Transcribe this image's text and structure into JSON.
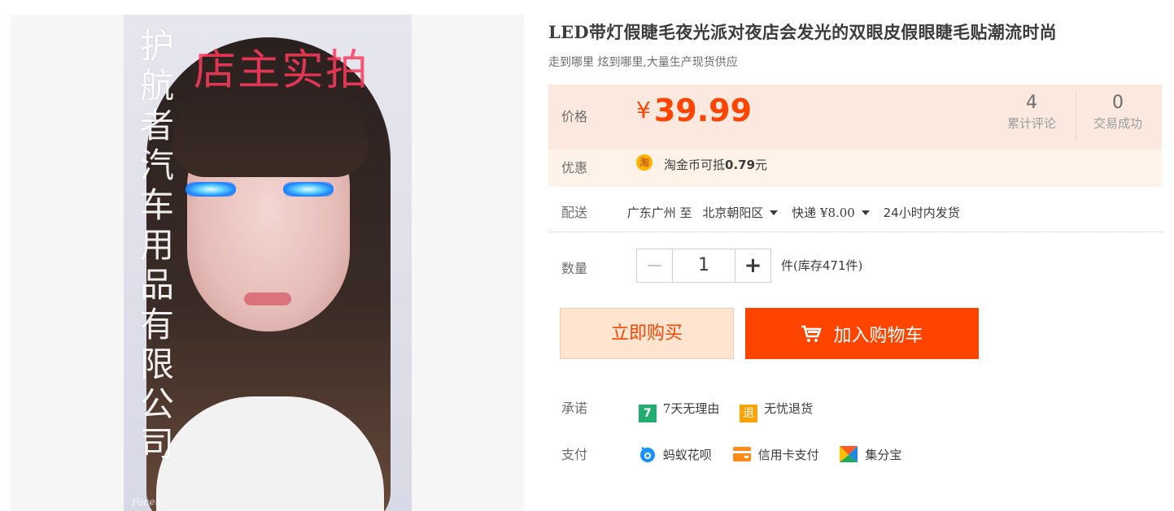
{
  "gallery": {
    "vertical_text": "护航者汽车用品有限公司",
    "stamp_text": "店主实拍",
    "signature": "Faceu"
  },
  "product": {
    "title": "LED带灯假睫毛夜光派对夜店会发光的双眼皮假眼睫毛贴潮流时尚",
    "subtitle": "走到哪里 炫到哪里,大量生产现货供应"
  },
  "price": {
    "label": "价格",
    "currency": "¥",
    "amount": "39.99"
  },
  "stats": [
    {
      "number": "4",
      "label": "累计评论"
    },
    {
      "number": "0",
      "label": "交易成功"
    }
  ],
  "promo": {
    "label": "优惠",
    "coin_icon_text": "淘",
    "text_prefix": "淘金币可抵",
    "amount": "0.79",
    "text_suffix": "元"
  },
  "delivery": {
    "label": "配送",
    "from": "广东广州 至",
    "to": "北京朝阳区",
    "method": "快递 ¥8.00",
    "ship_time_num": "24",
    "ship_time_text": "小时内发货"
  },
  "quantity": {
    "label": "数量",
    "minus": "−",
    "value": "1",
    "plus": "+",
    "stock_prefix": "件(库存",
    "stock": "471",
    "stock_suffix": "件)"
  },
  "actions": {
    "buy_now": "立即购买",
    "add_to_cart": "加入购物车"
  },
  "promise": {
    "label": "承诺",
    "items": [
      {
        "icon": "7",
        "icon_name": "seven-day-icon",
        "text": "7天无理由",
        "color": "#1fae6f"
      },
      {
        "icon": "退",
        "icon_name": "return-icon",
        "text": "无忧退货",
        "color": "#ffa200"
      }
    ]
  },
  "payment": {
    "label": "支付",
    "items": [
      {
        "icon_name": "huabei-icon",
        "text": "蚂蚁花呗"
      },
      {
        "icon_name": "credit-card-icon",
        "text": "信用卡支付"
      },
      {
        "icon_name": "jifenbao-icon",
        "text": "集分宝"
      }
    ]
  },
  "colors": {
    "price": "#ff4400",
    "buy_now_bg": "#ffe4d0",
    "cart_bg": "#ff4400"
  }
}
